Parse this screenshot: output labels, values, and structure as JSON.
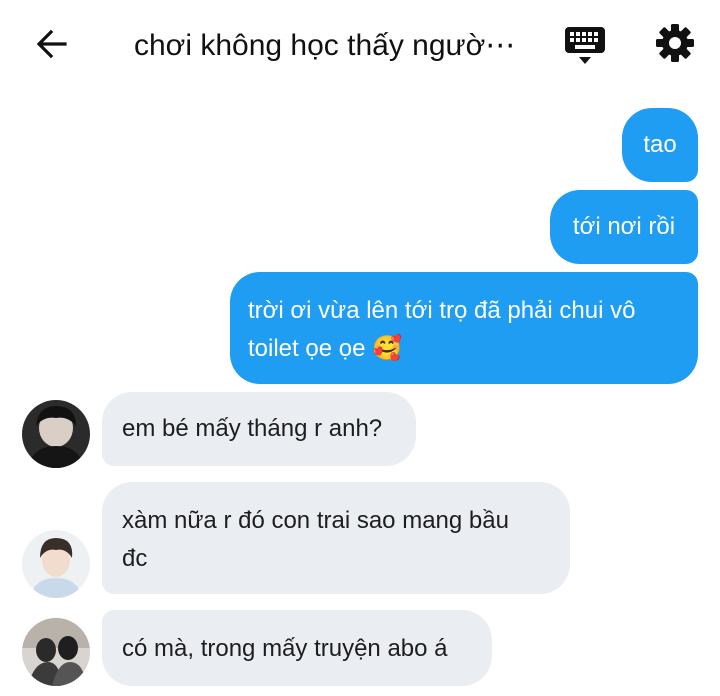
{
  "header": {
    "title": "chơi không học thấy ngườ⋯",
    "back_icon": "arrow-left-icon",
    "keyboard_icon": "keyboard-icon",
    "settings_icon": "gear-icon"
  },
  "colors": {
    "outgoing_bubble": "#1e9df2",
    "incoming_bubble": "#eaedf1"
  },
  "messages": [
    {
      "direction": "outgoing",
      "text": "tao"
    },
    {
      "direction": "outgoing",
      "text": "tới nơi rồi"
    },
    {
      "direction": "outgoing",
      "line1": "trời ơi vừa lên tới trọ đã phải chui vô",
      "line2": "toilet ọe ọe",
      "emoji": "🥰"
    },
    {
      "direction": "incoming",
      "text": "em bé mấy tháng r anh?"
    },
    {
      "direction": "incoming",
      "line1": "xàm nữa r đó con trai sao mang bầu",
      "line2": "đc"
    },
    {
      "direction": "incoming",
      "text": "có mà, trong mấy truyện abo á"
    }
  ]
}
